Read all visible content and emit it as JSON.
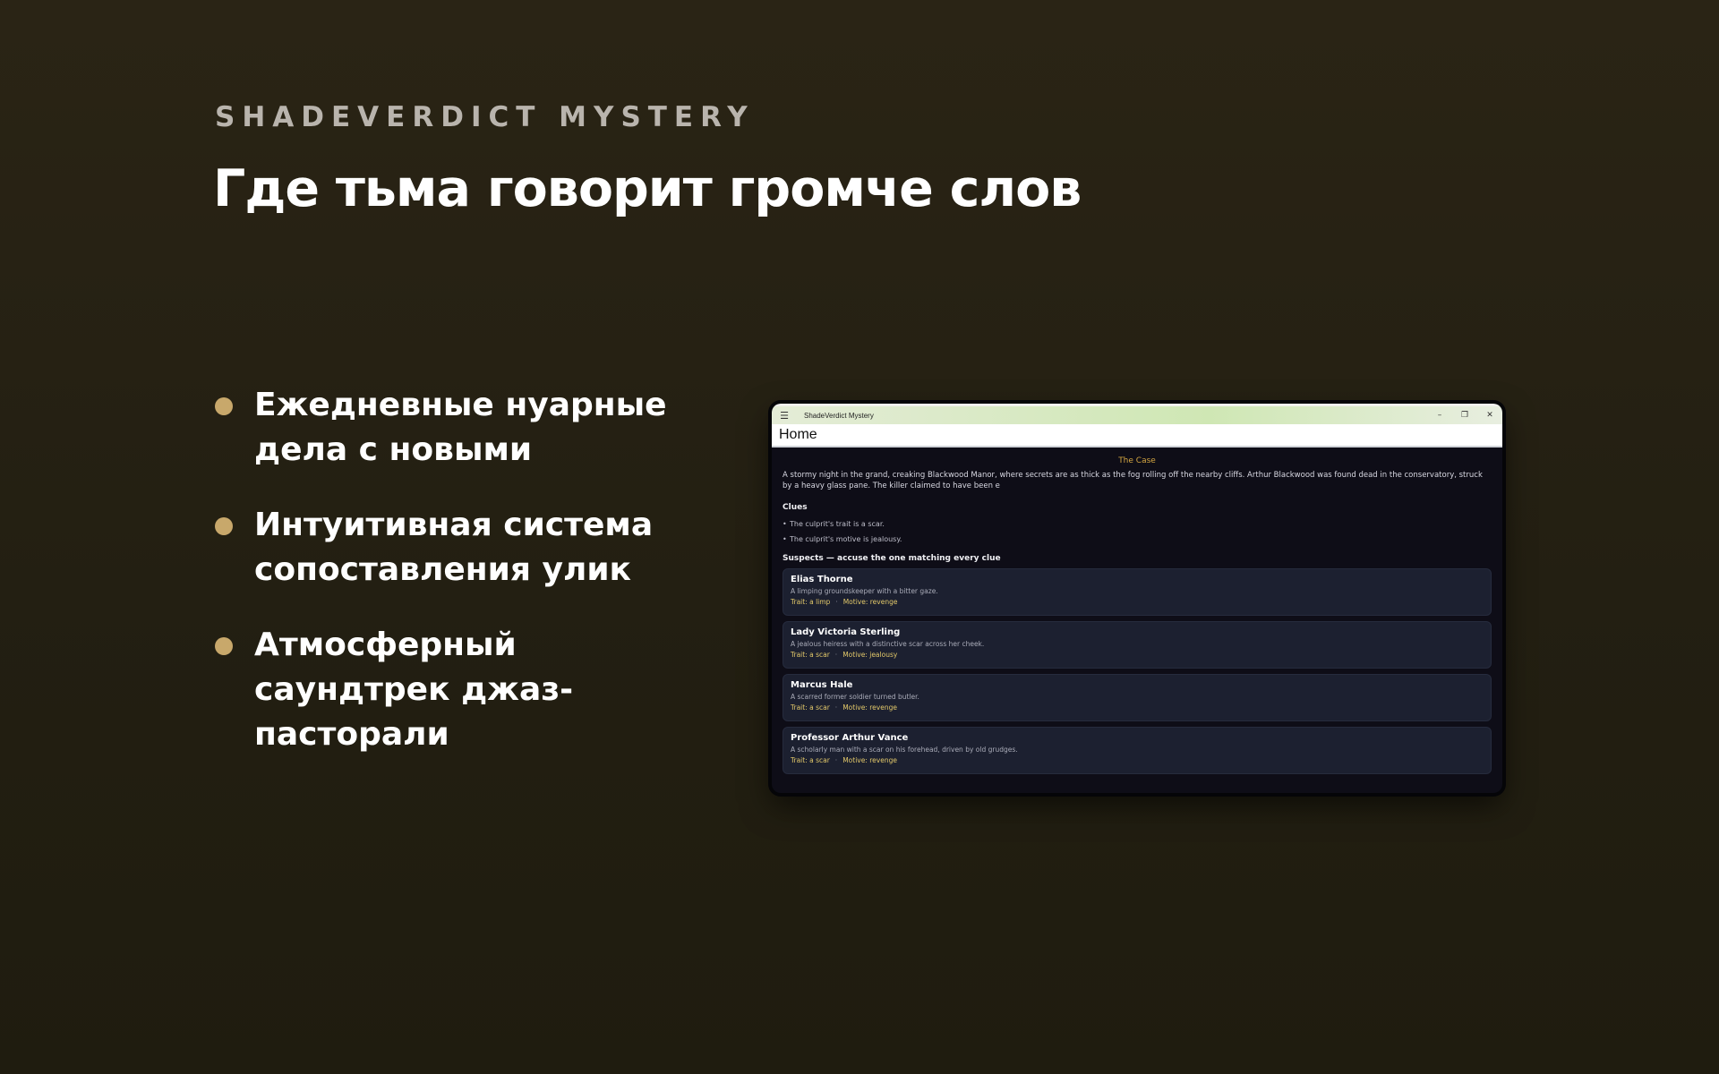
{
  "eyebrow": "SHADEVERDICT MYSTERY",
  "headline": "Где тьма говорит громче слов",
  "features": [
    "Ежедневные нуарные дела с новыми",
    "Интуитивная система сопоставления улик",
    "Атмосферный саундтрек джаз-пасторали"
  ],
  "window": {
    "title": "ShadeVerdict Mystery",
    "menu_icon": "hamburger-icon",
    "controls": [
      "minimize-icon",
      "restore-icon",
      "close-icon"
    ],
    "page_title": "Home"
  },
  "case": {
    "heading": "The Case",
    "text": "A stormy night in the grand, creaking Blackwood Manor, where secrets are as thick as the fog rolling off the nearby cliffs. Arthur Blackwood was found dead in the conservatory, struck by a heavy glass pane. The killer claimed to have been e"
  },
  "clues": {
    "title": "Clues",
    "items": [
      "The culprit's trait is a scar.",
      "The culprit's motive is jealousy."
    ]
  },
  "suspects": {
    "title": "Suspects — accuse the one matching every clue",
    "items": [
      {
        "name": "Elias Thorne",
        "desc": "A limping groundskeeper with a bitter gaze.",
        "trait": "Trait: a limp",
        "motive": "Motive: revenge"
      },
      {
        "name": "Lady Victoria Sterling",
        "desc": "A jealous heiress with a distinctive scar across her cheek.",
        "trait": "Trait: a scar",
        "motive": "Motive: jealousy"
      },
      {
        "name": "Marcus Hale",
        "desc": "A scarred former soldier turned butler.",
        "trait": "Trait: a scar",
        "motive": "Motive: revenge"
      },
      {
        "name": "Professor Arthur Vance",
        "desc": "A scholarly man with a scar on his forehead, driven by old grudges.",
        "trait": "Trait: a scar",
        "motive": "Motive: revenge"
      }
    ]
  },
  "colors": {
    "accent": "#c8a86b",
    "case_heading": "#d3a542",
    "meta": "#e3c96a"
  }
}
